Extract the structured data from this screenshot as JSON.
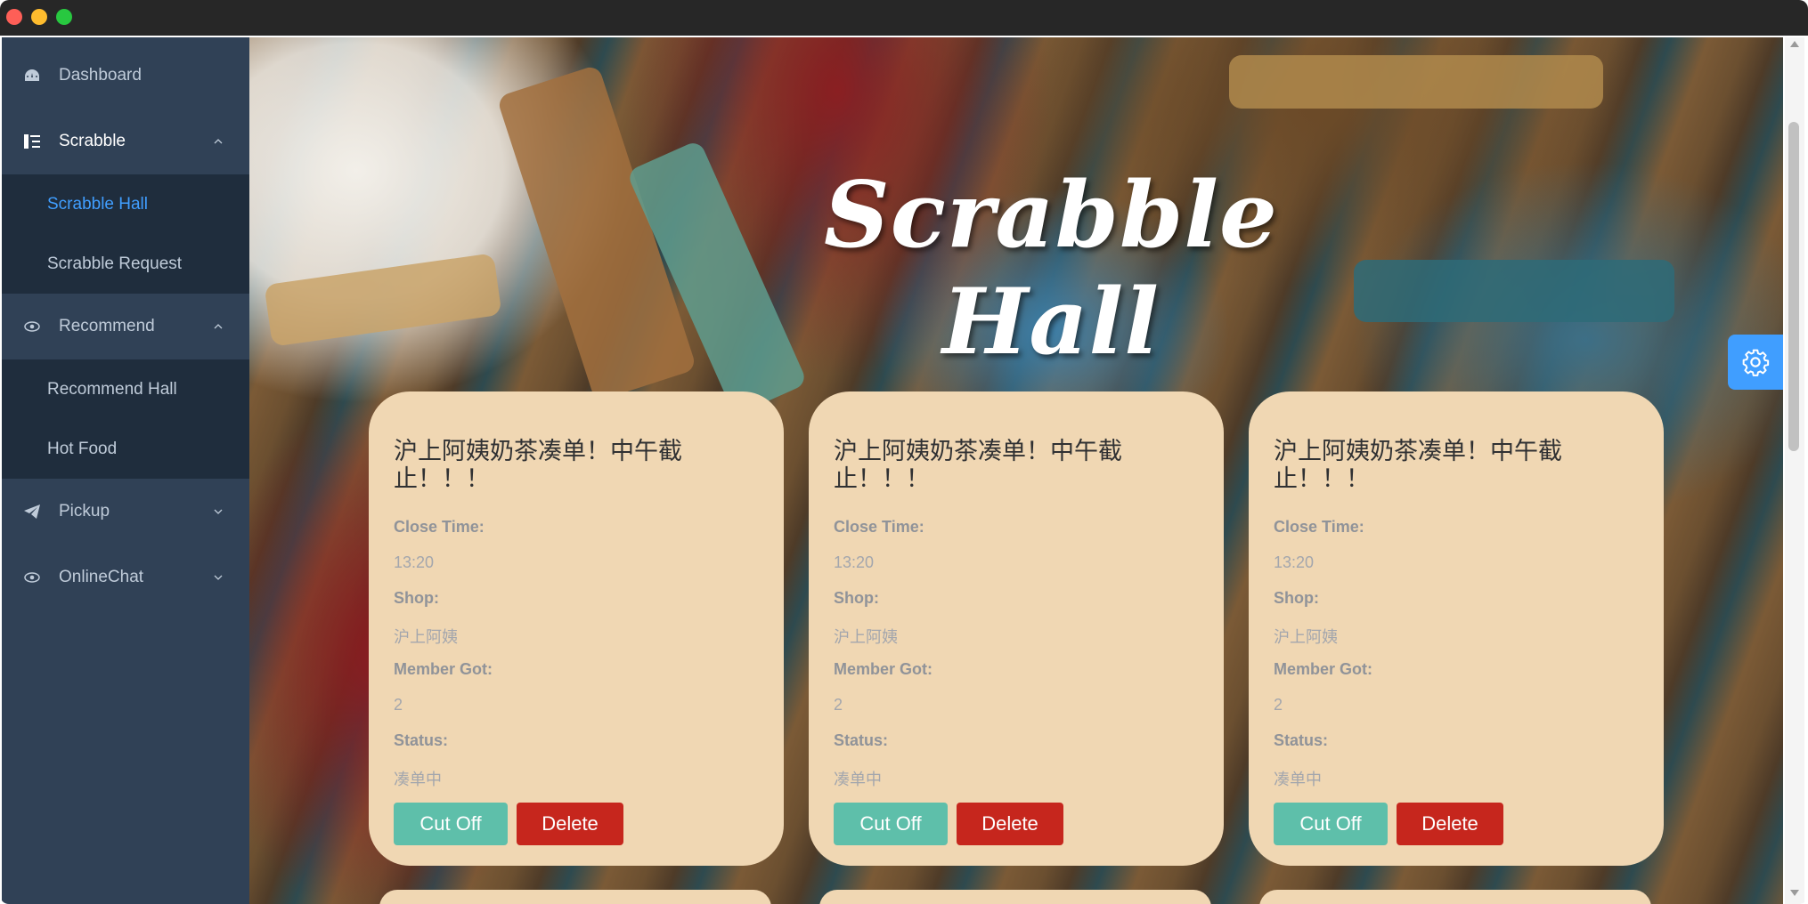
{
  "window": {
    "controls": [
      "close",
      "minimize",
      "maximize"
    ]
  },
  "sidebar": {
    "items": [
      {
        "label": "Dashboard",
        "icon": "dashboard-icon"
      },
      {
        "label": "Scrabble",
        "icon": "list-icon",
        "expanded": true,
        "children": [
          {
            "label": "Scrabble Hall",
            "active": true
          },
          {
            "label": "Scrabble Request"
          }
        ]
      },
      {
        "label": "Recommend",
        "icon": "eye-icon",
        "expanded": true,
        "children": [
          {
            "label": "Recommend Hall"
          },
          {
            "label": "Hot Food"
          }
        ]
      },
      {
        "label": "Pickup",
        "icon": "send-icon",
        "expanded": false
      },
      {
        "label": "OnlineChat",
        "icon": "eye-icon",
        "expanded": false
      }
    ]
  },
  "hero": {
    "title": "Scrabble Hall"
  },
  "fields": {
    "close_time": "Close Time:",
    "shop": "Shop:",
    "member_got": "Member Got:",
    "status": "Status:"
  },
  "buttons": {
    "cut_off": "Cut Off",
    "delete": "Delete"
  },
  "cards": [
    {
      "title": "沪上阿姨奶茶凑单！中午截止！！！",
      "close_time": "13:20",
      "shop": "沪上阿姨",
      "member_got": "2",
      "status": "凑单中"
    },
    {
      "title": "沪上阿姨奶茶凑单！中午截止！！！",
      "close_time": "13:20",
      "shop": "沪上阿姨",
      "member_got": "2",
      "status": "凑单中"
    },
    {
      "title": "沪上阿姨奶茶凑单！中午截止！！！",
      "close_time": "13:20",
      "shop": "沪上阿姨",
      "member_got": "2",
      "status": "凑单中"
    }
  ],
  "colors": {
    "sidebar_bg": "#304156",
    "submenu_bg": "#1f2d3d",
    "active_link": "#409eff",
    "card_bg": "#f0d7b3",
    "cut_off_button": "#5ebfaa",
    "delete_button": "#c6261d",
    "settings_button": "#409eff"
  }
}
